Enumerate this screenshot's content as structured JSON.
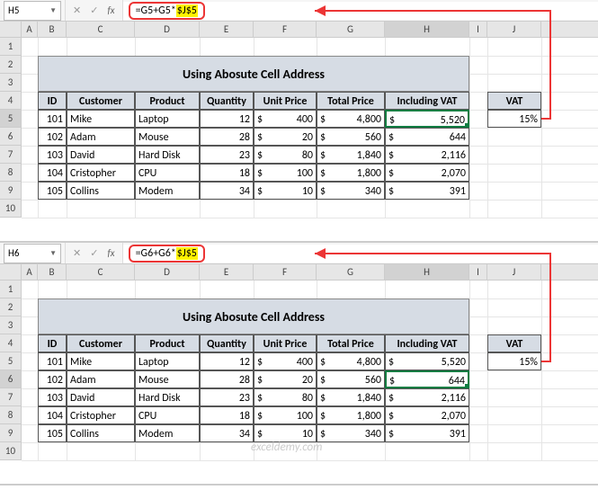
{
  "panels": [
    {
      "nameBox": "H5",
      "formulaPrefix": "=G5+G5*",
      "formulaAbs": "$J$5",
      "selectedCol": "H",
      "selectedRow": "5"
    },
    {
      "nameBox": "H6",
      "formulaPrefix": "=G6+G6*",
      "formulaAbs": "$J$5",
      "selectedCol": "H",
      "selectedRow": "6"
    }
  ],
  "columns": [
    "A",
    "B",
    "C",
    "D",
    "E",
    "F",
    "G",
    "H",
    "I",
    "J"
  ],
  "colWidths": {
    "A": 18,
    "B": 32,
    "C": 76,
    "D": 72,
    "E": 60,
    "F": 70,
    "G": 76,
    "H": 94,
    "I": 20,
    "J": 60
  },
  "title": "Using Abosute Cell Address",
  "headers": {
    "id": "ID",
    "customer": "Customer",
    "product": "Product",
    "quantity": "Quantity",
    "unitPrice": "Unit Price",
    "totalPrice": "Total Price",
    "includingVat": "Including VAT",
    "vat": "VAT"
  },
  "vatValue": "15%",
  "currencySymbol": "$",
  "chart_data": {
    "type": "table",
    "columns": [
      "ID",
      "Customer",
      "Product",
      "Quantity",
      "Unit Price",
      "Total Price",
      "Including VAT"
    ],
    "rows": [
      {
        "id": 101,
        "customer": "Mike",
        "product": "Laptop",
        "quantity": 12,
        "unitPrice": 400,
        "totalPrice": 4800,
        "includingVat": 5520
      },
      {
        "id": 102,
        "customer": "Adam",
        "product": "Mouse",
        "quantity": 28,
        "unitPrice": 20,
        "totalPrice": 560,
        "includingVat": 644
      },
      {
        "id": 103,
        "customer": "David",
        "product": "Hard Disk",
        "quantity": 23,
        "unitPrice": 80,
        "totalPrice": 1840,
        "includingVat": 2116
      },
      {
        "id": 104,
        "customer": "Cristopher",
        "product": "CPU",
        "quantity": 18,
        "unitPrice": 100,
        "totalPrice": 1800,
        "includingVat": 2070
      },
      {
        "id": 105,
        "customer": "Collins",
        "product": "Modem",
        "quantity": 34,
        "unitPrice": 10,
        "totalPrice": 340,
        "includingVat": 391
      }
    ],
    "vat": 0.15
  },
  "watermark": "exceldemy.com"
}
